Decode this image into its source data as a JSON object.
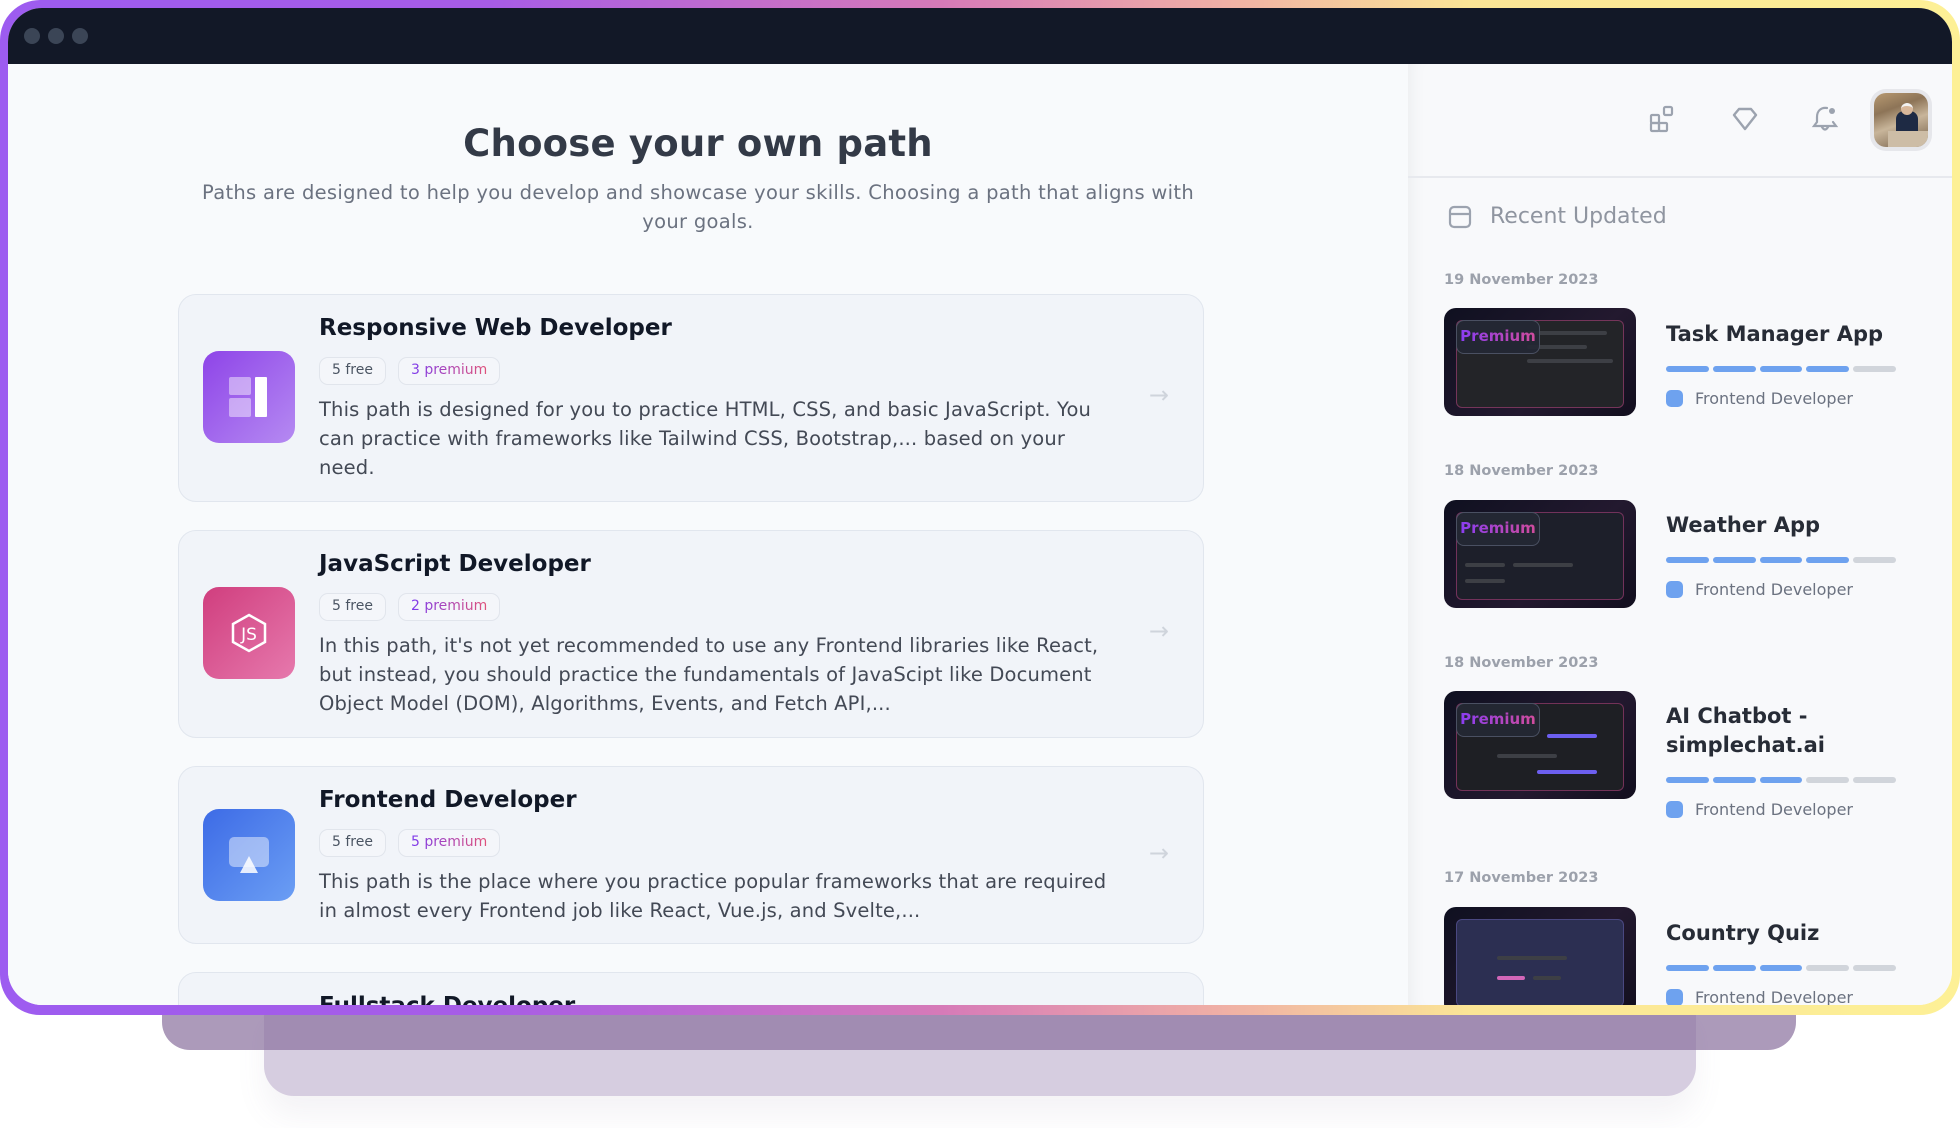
{
  "window": {
    "traffic_lights": [
      "close",
      "minimize",
      "maximize"
    ]
  },
  "main": {
    "title": "Choose your own path",
    "subtitle": "Paths are designed to help you develop and showcase your skills. Choosing a path that aligns with your goals.",
    "paths": [
      {
        "title": "Responsive Web Developer",
        "icon": "layout-icon",
        "color": "#9b55ea",
        "free": "5 free",
        "premium": "3 premium",
        "description": "This path is designed for you to practice HTML, CSS, and basic JavaScript. You can practice with frameworks like Tailwind CSS, Bootstrap,... based on your need."
      },
      {
        "title": "JavaScript Developer",
        "icon": "javascript-icon",
        "color": "#d94f8c",
        "free": "5 free",
        "premium": "2 premium",
        "description": "In this path, it's not yet recommended to use any Frontend libraries like React, but instead, you should practice the fundamentals of JavaScipt like Document Object Model (DOM), Algorithms, Events, and Fetch API,..."
      },
      {
        "title": "Frontend Developer",
        "icon": "monitor-icon",
        "color": "#4f7fec",
        "free": "5 free",
        "premium": "5 premium",
        "description": "This path is the place where you practice popular frameworks that are required in almost every Frontend job like React, Vue.js, and Svelte,..."
      },
      {
        "title": "Fullstack Developer"
      }
    ]
  },
  "sidebar": {
    "topbar_icons": [
      "widgets-icon",
      "diamond-icon",
      "bell-notification-icon"
    ],
    "avatar_alt": "User avatar",
    "section_label": "Recent Updated",
    "section_icon": "calendar-icon",
    "items": [
      {
        "date": "19 November 2023",
        "title": "Task Manager App",
        "premium": "Premium",
        "progress": 0.8,
        "steps_done": 4,
        "steps_total": 5,
        "tag": "Frontend Developer"
      },
      {
        "date": "18 November 2023",
        "title": "Weather App",
        "premium": "Premium",
        "progress": 0.8,
        "steps_done": 4,
        "steps_total": 5,
        "tag": "Frontend Developer"
      },
      {
        "date": "18 November 2023",
        "title": "AI Chatbot - simplechat.ai",
        "premium": "Premium",
        "progress": 0.6,
        "steps_done": 3,
        "steps_total": 5,
        "tag": "Frontend Developer"
      },
      {
        "date": "17 November 2023",
        "title": "Country Quiz",
        "premium": "",
        "progress": 0.6,
        "steps_done": 3,
        "steps_total": 5,
        "tag": "Frontend Developer"
      }
    ],
    "accent": "#6ea2ef"
  }
}
